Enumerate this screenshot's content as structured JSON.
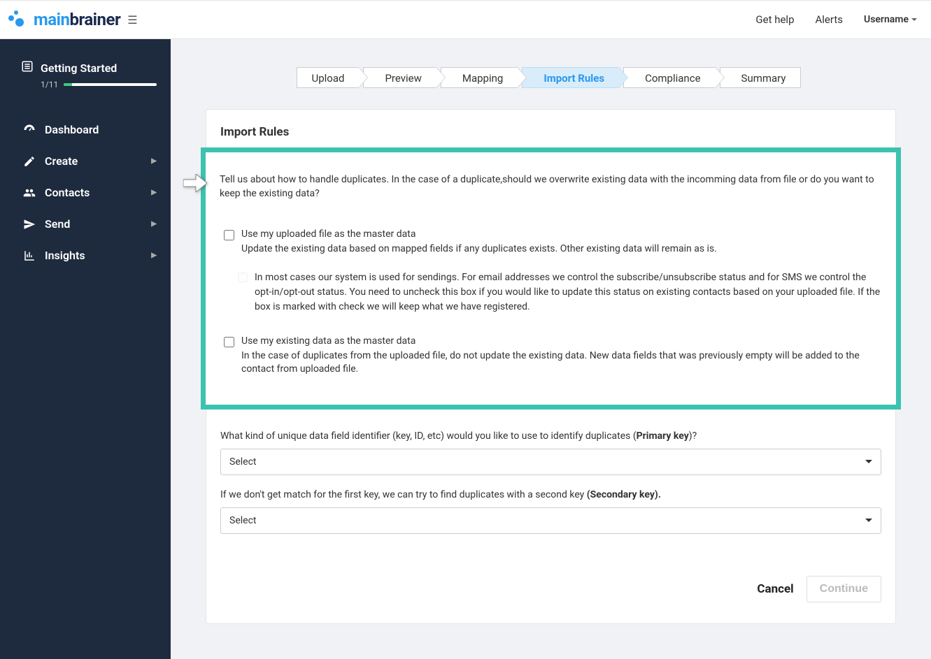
{
  "brand": {
    "part1": "main",
    "part2": "brainer"
  },
  "topbar": {
    "get_help": "Get help",
    "alerts": "Alerts",
    "username": "Username"
  },
  "sidebar": {
    "getting_started": {
      "title": "Getting Started",
      "count": "1/11"
    },
    "items": [
      {
        "label": "Dashboard"
      },
      {
        "label": "Create"
      },
      {
        "label": "Contacts"
      },
      {
        "label": "Send"
      },
      {
        "label": "Insights"
      }
    ]
  },
  "wizard": {
    "steps": [
      "Upload",
      "Preview",
      "Mapping",
      "Import Rules",
      "Compliance",
      "Summary"
    ],
    "active_index": 3
  },
  "panel": {
    "title": "Import Rules",
    "intro": "Tell us about how to handle duplicates. In the case of a duplicate,should we overwrite existing data with the incomming data from file or do you want to keep the existing data?",
    "opt1": {
      "label": "Use my uploaded file as the master data",
      "desc": "Update the existing data based on mapped fields if any duplicates exists. Other existing data will remain as is."
    },
    "sub_opt": "In most cases our system is used for sendings. For email addresses we control the subscribe/unsubscribe status and for SMS we control the opt-in/opt-out status. You need to uncheck this box if you would like to update this status on existing contacts based on your uploaded file. If the box is marked with check we will keep what we have registered.",
    "opt2": {
      "label": "Use my existing data as the master data",
      "desc": "In the case of duplicates from the uploaded file, do not update the existing data. New data fields that was previously empty will be added to the contact from uploaded file."
    },
    "primary_key": {
      "label_pre": "What kind of unique data field identifier (key, ID, etc) would you like to use to identify duplicates (",
      "label_bold": "Primary key",
      "label_post": ")?",
      "value": "Select"
    },
    "secondary_key": {
      "label_pre": "If we don't get match for the first key, we can try to find duplicates with a second key ",
      "label_bold": "(Secondary key).",
      "value": "Select"
    },
    "cancel": "Cancel",
    "continue": "Continue"
  }
}
